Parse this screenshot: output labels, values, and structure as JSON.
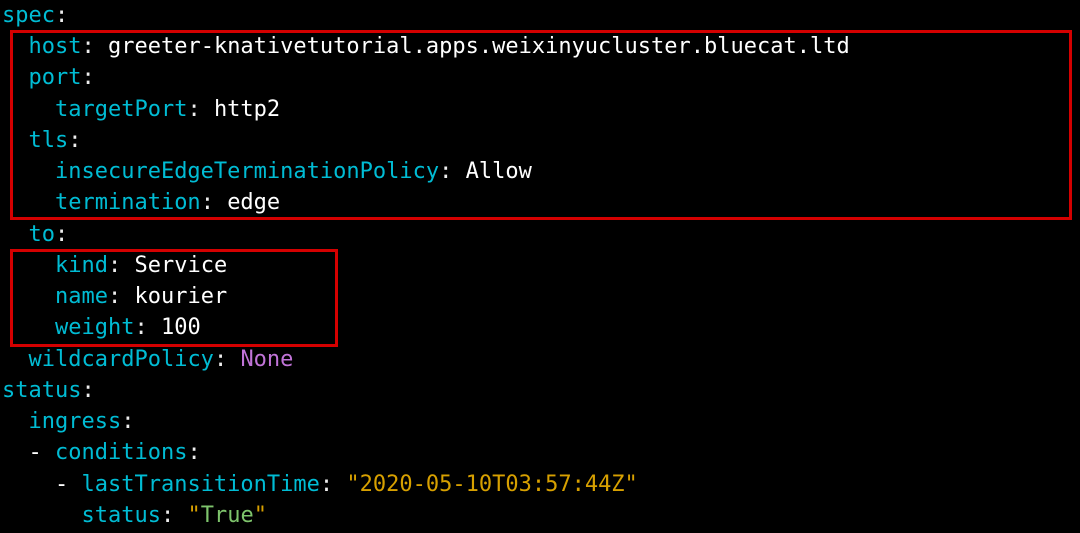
{
  "yaml": {
    "spec": {
      "host_key": "host",
      "host_val": "greeter-knativetutorial.apps.weixinyucluster.bluecat.ltd",
      "port_key": "port",
      "targetPort_key": "targetPort",
      "targetPort_val": "http2",
      "tls_key": "tls",
      "insecure_key": "insecureEdgeTerminationPolicy",
      "insecure_val": "Allow",
      "termination_key": "termination",
      "termination_val": "edge",
      "to_key": "to",
      "kind_key": "kind",
      "kind_val": "Service",
      "name_key": "name",
      "name_val": "kourier",
      "weight_key": "weight",
      "weight_val": "100",
      "wildcard_key": "wildcardPolicy",
      "wildcard_val": "None"
    },
    "spec_key": "spec",
    "status_key": "status",
    "status": {
      "ingress_key": "ingress",
      "conditions_key": "conditions",
      "ltt_key": "lastTransitionTime",
      "ltt_val": "\"2020-05-10T03:57:44Z\"",
      "status_inner_key": "status",
      "status_inner_val": "True"
    }
  },
  "dash": "-",
  "colon": ":",
  "quote": "\""
}
